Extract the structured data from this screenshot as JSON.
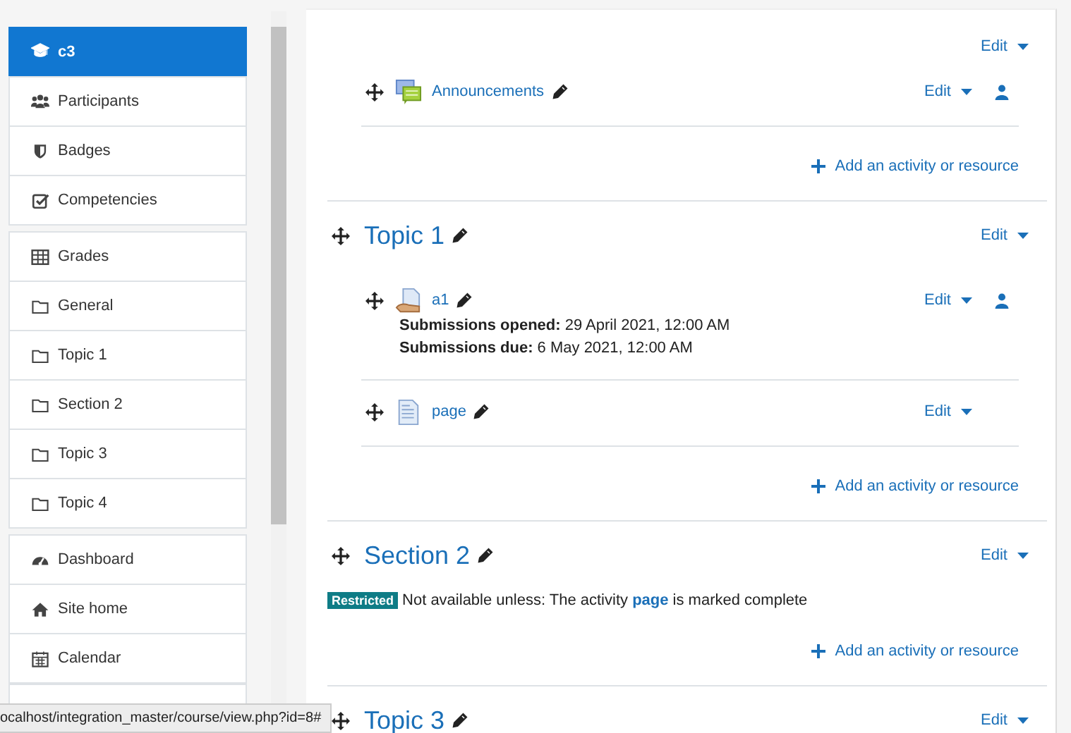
{
  "sidebar": {
    "groups": [
      {
        "items": [
          {
            "label": "c3",
            "kind": "course",
            "selected": true
          },
          {
            "label": "Participants",
            "kind": "users",
            "selected": false
          },
          {
            "label": "Badges",
            "kind": "badge",
            "selected": false
          },
          {
            "label": "Competencies",
            "kind": "check",
            "selected": false
          }
        ]
      },
      {
        "items": [
          {
            "label": "Grades",
            "kind": "table",
            "selected": false
          },
          {
            "label": "General",
            "kind": "folder",
            "selected": false
          },
          {
            "label": "Topic 1",
            "kind": "folder",
            "selected": false
          },
          {
            "label": "Section 2",
            "kind": "folder",
            "selected": false
          },
          {
            "label": "Topic 3",
            "kind": "folder",
            "selected": false
          },
          {
            "label": "Topic 4",
            "kind": "folder",
            "selected": false
          }
        ]
      },
      {
        "items": [
          {
            "label": "Dashboard",
            "kind": "gauge",
            "selected": false
          },
          {
            "label": "Site home",
            "kind": "home",
            "selected": false
          },
          {
            "label": "Calendar",
            "kind": "calendar",
            "selected": false
          }
        ]
      }
    ]
  },
  "sections": [
    {
      "edit": "Edit",
      "activities": [
        {
          "kind": "forum",
          "name": "Announcements",
          "edit": "Edit",
          "user_icon": true
        }
      ],
      "add": "Add an activity or resource"
    },
    {
      "title": "Topic 1",
      "edit": "Edit",
      "activities": [
        {
          "kind": "assign",
          "name": "a1",
          "edit": "Edit",
          "user_icon": true,
          "details": [
            {
              "label": "Submissions opened:",
              "value": "29 April 2021, 12:00 AM"
            },
            {
              "label": "Submissions due:",
              "value": "6 May 2021, 12:00 AM"
            }
          ]
        },
        {
          "kind": "page",
          "name": "page",
          "edit": "Edit",
          "user_icon": false
        }
      ],
      "add": "Add an activity or resource"
    },
    {
      "title": "Section 2",
      "edit": "Edit",
      "availability": {
        "badge": "Restricted",
        "before": "Not available unless: The activity",
        "link": "page",
        "after": "is marked complete"
      },
      "add": "Add an activity or resource"
    },
    {
      "title": "Topic 3",
      "edit": "Edit"
    }
  ],
  "status_bar": {
    "url": "ocalhost/integration_master/course/view.php?id=8#"
  }
}
